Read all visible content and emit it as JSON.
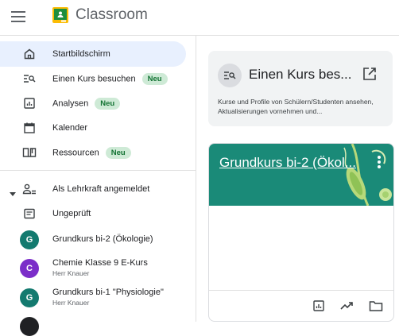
{
  "app": {
    "title": "Classroom"
  },
  "colors": {
    "active_bg": "#e8f0fe",
    "badge_bg": "#ceead6",
    "badge_text": "#137333",
    "card_header": "#1a8a78"
  },
  "sidebar": {
    "nav": [
      {
        "label": "Startbildschirm",
        "icon": "home-icon",
        "active": true
      },
      {
        "label": "Einen Kurs besuchen",
        "icon": "list-search-icon",
        "badge": "Neu"
      },
      {
        "label": "Analysen",
        "icon": "analytics-icon",
        "badge": "Neu"
      },
      {
        "label": "Kalender",
        "icon": "calendar-icon"
      },
      {
        "label": "Ressourcen",
        "icon": "book-icon",
        "badge": "Neu"
      }
    ],
    "teacher_section": {
      "label": "Als Lehrkraft angemeldet",
      "icon": "people-icon"
    },
    "unreviewed": {
      "label": "Ungeprüft",
      "icon": "inbox-icon"
    },
    "courses": [
      {
        "letter": "G",
        "name": "Grundkurs bi-2 (Ökologie)",
        "teacher": "",
        "color": "#137a6f"
      },
      {
        "letter": "C",
        "name": "Chemie Klasse 9 E-Kurs",
        "teacher": "Herr Knauer",
        "color": "#7b2ec9"
      },
      {
        "letter": "G",
        "name": "Grundkurs bi-1 \"Physiologie\"",
        "teacher": "Herr Knauer",
        "color": "#137a6f"
      }
    ]
  },
  "visit_card": {
    "title": "Einen Kurs bes...",
    "description": "Kurse und Profile von Schülern/Studenten ansehen, Aktualisierungen vornehmen und..."
  },
  "course_card": {
    "title": "Grundkurs bi-2 (Ökol..."
  }
}
